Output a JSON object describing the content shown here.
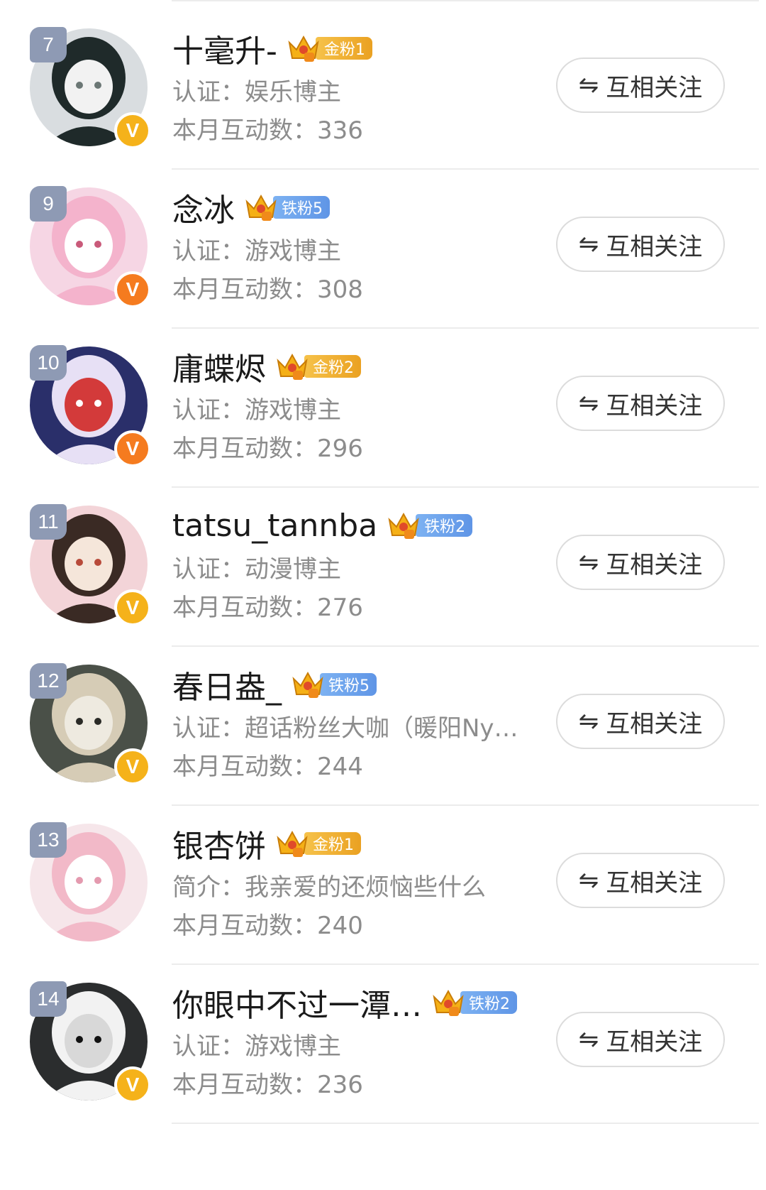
{
  "rows": [
    {
      "rank": "7",
      "name": "十毫升-",
      "badge": {
        "type": "gold",
        "label": "金粉1"
      },
      "info": "认证：娱乐博主",
      "count": "本月互动数：336",
      "verify": "gold",
      "button": "互相关注"
    },
    {
      "rank": "9",
      "name": "念冰",
      "badge": {
        "type": "iron",
        "label": "铁粉5"
      },
      "info": "认证：游戏博主",
      "count": "本月互动数：308",
      "verify": "orange",
      "button": "互相关注"
    },
    {
      "rank": "10",
      "name": "庸蝶烬",
      "badge": {
        "type": "gold",
        "label": "金粉2"
      },
      "info": "认证：游戏博主",
      "count": "本月互动数：296",
      "verify": "orange",
      "button": "互相关注"
    },
    {
      "rank": "11",
      "name": "tatsu_tannba",
      "badge": {
        "type": "iron",
        "label": "铁粉2"
      },
      "info": "认证：动漫博主",
      "count": "本月互动数：276",
      "verify": "gold",
      "button": "互相关注"
    },
    {
      "rank": "12",
      "name": "春日盎_",
      "badge": {
        "type": "iron",
        "label": "铁粉5"
      },
      "info": "认证：超话粉丝大咖（暖阳Ny…",
      "count": "本月互动数：244",
      "verify": "gold",
      "button": "互相关注"
    },
    {
      "rank": "13",
      "name": "银杏饼",
      "badge": {
        "type": "gold",
        "label": "金粉1"
      },
      "info": "简介：我亲爱的还烦恼些什么",
      "count": "本月互动数：240",
      "verify": "",
      "button": "互相关注"
    },
    {
      "rank": "14",
      "name": "你眼中不过一潭…",
      "badge": {
        "type": "iron",
        "label": "铁粉2"
      },
      "info": "认证：游戏博主",
      "count": "本月互动数：236",
      "verify": "gold",
      "button": "互相关注"
    }
  ],
  "icons": {
    "follow_swap": "swap-arrows-icon",
    "badge_crown": "crown-icon",
    "verify": "verified-v-icon"
  },
  "colors": {
    "gold_badge": "#eaa122",
    "iron_badge": "#5f95e6",
    "verify_gold": "#f5b21a",
    "verify_orange": "#f57b1f",
    "rank_tag": "#8e9ab4"
  },
  "swap_glyph": "⇋",
  "verify_glyph": "V"
}
